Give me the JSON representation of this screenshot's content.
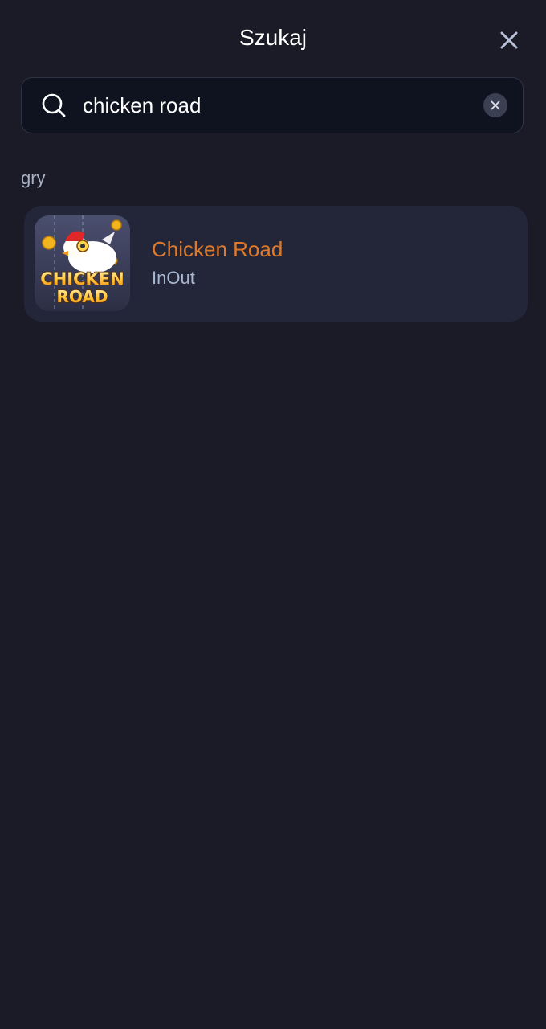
{
  "header": {
    "title": "Szukaj"
  },
  "search": {
    "value": "chicken road"
  },
  "section": {
    "label": "gry"
  },
  "results": [
    {
      "title": "Chicken Road",
      "provider": "InOut",
      "logo_text": "CHICKEN ROAD"
    }
  ],
  "colors": {
    "background": "#1a1b27",
    "card": "#222638",
    "accent_title": "#e07a2b",
    "provider_text": "#a9b8d2"
  },
  "icons": {
    "close": "close-icon",
    "search": "search-icon",
    "clear": "clear-icon"
  }
}
